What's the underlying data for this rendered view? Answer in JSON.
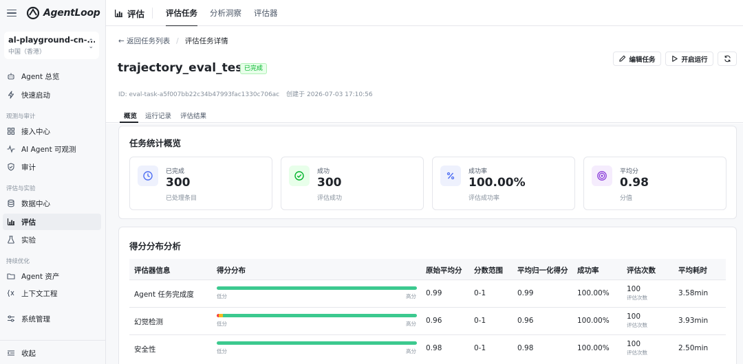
{
  "brand": {
    "name": "AgentLoop"
  },
  "workspace": {
    "name": "al-playground-cn-...",
    "region": "中国（香港）"
  },
  "sidebar": {
    "items": [
      {
        "label": "Agent 总览",
        "icon": "robot-icon"
      },
      {
        "label": "快速启动",
        "icon": "lightning-icon"
      },
      {
        "label": "接入中心",
        "icon": "grid-icon"
      },
      {
        "label": "AI Agent 可观测",
        "icon": "pulse-icon"
      },
      {
        "label": "审计",
        "icon": "shield-icon"
      },
      {
        "label": "数据中心",
        "icon": "database-icon"
      },
      {
        "label": "评估",
        "icon": "bar-chart-icon"
      },
      {
        "label": "实验",
        "icon": "flask-icon"
      },
      {
        "label": "Agent 资产",
        "icon": "folder-icon"
      },
      {
        "label": "上下文工程",
        "icon": "context-icon"
      },
      {
        "label": "系统管理",
        "icon": "settings-icon"
      }
    ],
    "groups": [
      "观测与审计",
      "评估与实验",
      "持续优化"
    ],
    "collapse_label": "收起"
  },
  "topbar": {
    "title": "评估",
    "tabs": [
      "评估任务",
      "分析洞察",
      "评估器"
    ]
  },
  "breadcrumb": {
    "back": "返回任务列表",
    "current": "评估任务详情"
  },
  "task": {
    "name": "trajectory_eval_test",
    "status": "已完成",
    "id_text": "ID: eval-task-a5f007bb22c34b47993fac1330c706ac",
    "created_text": "创建于 2026-07-03 17:10:56"
  },
  "actions": {
    "edit": "编辑任务",
    "run": "开启运行"
  },
  "subtabs": [
    "概览",
    "运行记录",
    "评估结果"
  ],
  "overview": {
    "title": "任务统计概览",
    "stats": [
      {
        "label": "已完成",
        "value": "300",
        "sub": "已处理条目",
        "icon": "clock-icon",
        "color": "#4e6ef2"
      },
      {
        "label": "成功",
        "value": "300",
        "sub": "评估成功",
        "icon": "check-circle-icon",
        "color": "#00b42a"
      },
      {
        "label": "成功率",
        "value": "100.00%",
        "sub": "评估成功率",
        "icon": "percent-icon",
        "color": "#4e6ef2"
      },
      {
        "label": "平均分",
        "value": "0.98",
        "sub": "分值",
        "icon": "target-icon",
        "color": "#8b3fd9"
      }
    ]
  },
  "distribution": {
    "title": "得分分布分析",
    "columns": [
      "评估器信息",
      "得分分布",
      "原始平均分",
      "分数范围",
      "平均归一化得分",
      "成功率",
      "评估次数",
      "平均耗时"
    ],
    "low_label": "低分",
    "high_label": "高分",
    "count_sub": "评估次数",
    "rows": [
      {
        "name": "Agent 任务完成度",
        "avg": "0.99",
        "range": "0-1",
        "norm": "0.99",
        "rate": "100.00%",
        "count": "100",
        "time": "3.58min",
        "dist": {
          "low": 0,
          "mid": 0,
          "high": 1.0
        }
      },
      {
        "name": "幻觉检测",
        "avg": "0.96",
        "range": "0-1",
        "norm": "0.96",
        "rate": "100.00%",
        "count": "100",
        "time": "3.93min",
        "dist": {
          "low": 0.01,
          "mid": 0.02,
          "high": 0.97
        }
      },
      {
        "name": "安全性",
        "avg": "0.98",
        "range": "0-1",
        "norm": "0.98",
        "rate": "100.00%",
        "count": "100",
        "time": "2.50min",
        "dist": {
          "low": 0,
          "mid": 0,
          "high": 1.0
        }
      }
    ]
  },
  "colors": {
    "accent": "#1f2329",
    "success": "#00b42a",
    "bar_high": "#3cc98f",
    "bar_mid": "#f7ba1e",
    "bar_low": "#f53f3f"
  }
}
